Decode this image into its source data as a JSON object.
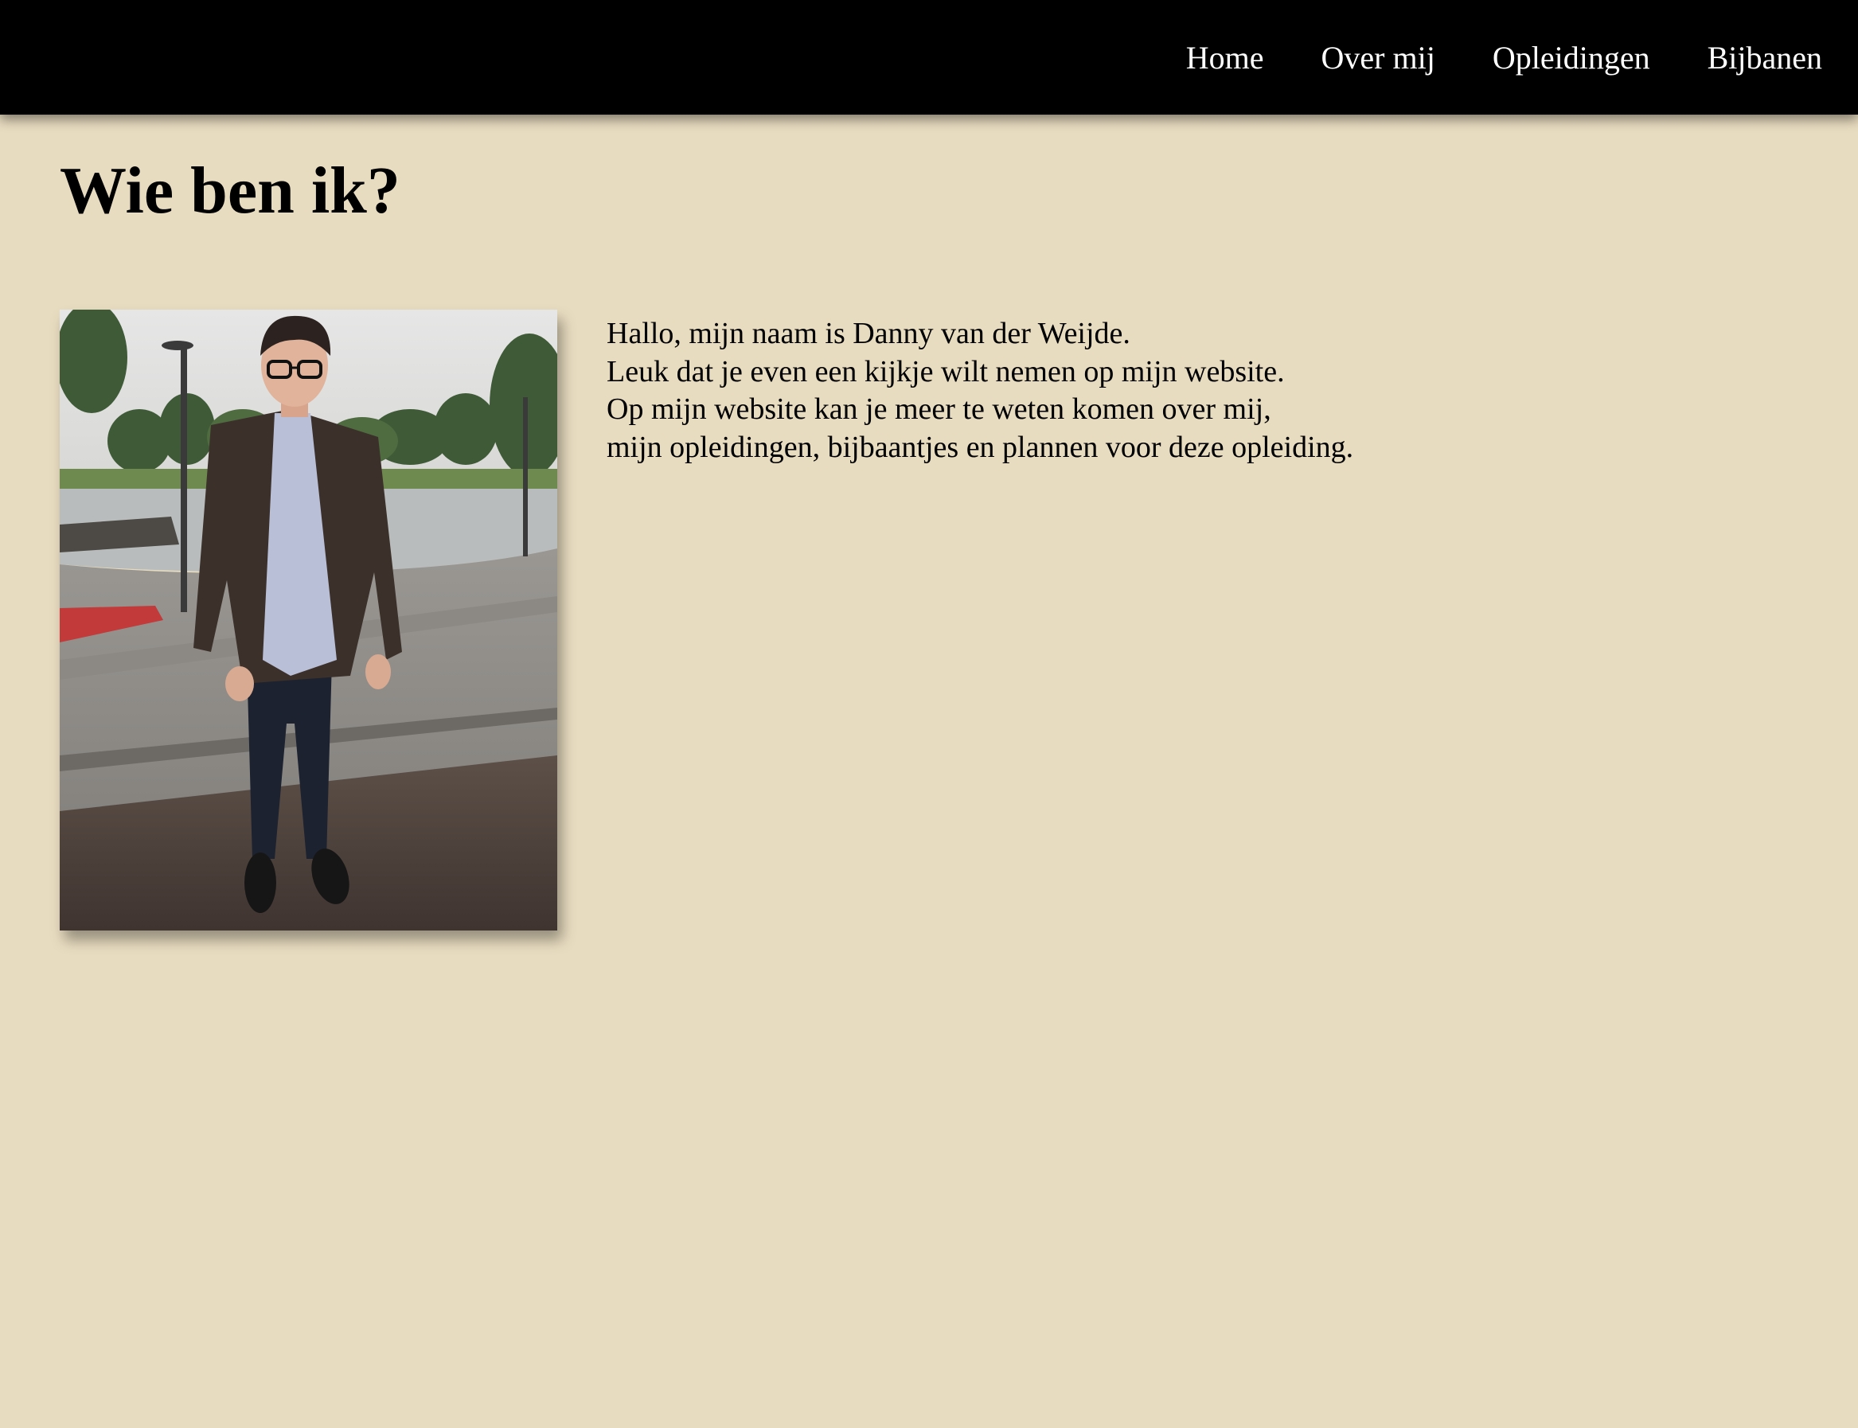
{
  "nav": {
    "items": [
      {
        "label": "Home"
      },
      {
        "label": "Over mij"
      },
      {
        "label": "Opleidingen"
      },
      {
        "label": "Bijbanen"
      }
    ]
  },
  "main": {
    "title": "Wie ben ik?",
    "intro_lines": [
      "Hallo, mijn naam is Danny van der Weijde.",
      "Leuk dat je even een kijkje wilt nemen op mijn website.",
      "Op mijn website kan je meer te weten komen over mij,",
      "mijn opleidingen, bijbaantjes en plannen voor deze opleiding."
    ]
  },
  "colors": {
    "background": "#e8dcc0",
    "navbar": "#000000",
    "nav_text": "#ffffff"
  }
}
